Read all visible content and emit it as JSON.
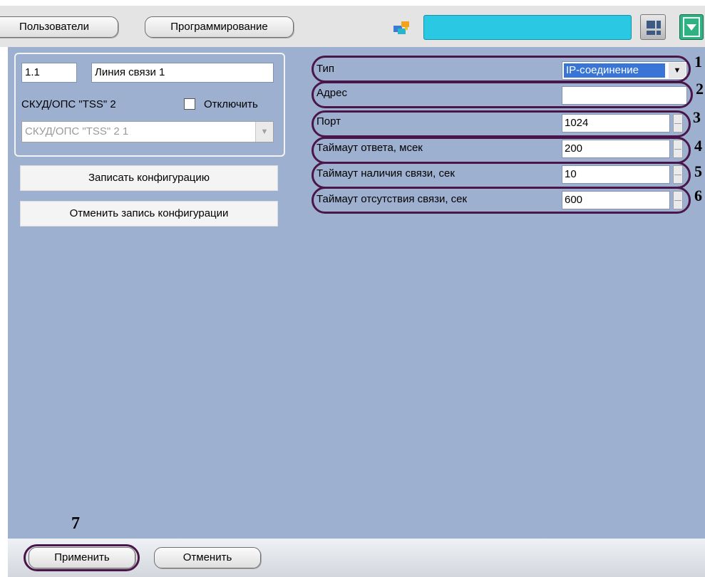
{
  "top_bar": {
    "users_label": "Пользователи",
    "programming_label": "Программирование"
  },
  "object": {
    "id": "1.1",
    "name": "Линия связи 1",
    "parent": "СКУД/ОПС \"TSS\" 2",
    "disable_label": "Отключить",
    "parent_combo": "СКУД/ОПС \"TSS\" 2 1"
  },
  "buttons": {
    "write_config": "Записать конфигурацию",
    "cancel_write_config": "Отменить запись конфигурации",
    "apply": "Применить",
    "cancel": "Отменить"
  },
  "properties": {
    "type_label": "Тип",
    "type_value": "IP-соединение",
    "address_label": "Адрес",
    "address_value": "",
    "port_label": "Порт",
    "port_value": "1024",
    "response_timeout_label": "Таймаут ответа, мсек",
    "response_timeout_value": "200",
    "connection_timeout_label": "Таймаут наличия связи, сек",
    "connection_timeout_value": "10",
    "disconnection_timeout_label": "Таймаут отсутствия связи, сек",
    "disconnection_timeout_value": "600"
  },
  "callouts": [
    "1",
    "2",
    "3",
    "4",
    "5",
    "6",
    "7"
  ],
  "colors": {
    "panel": "#9db0d0",
    "highlight_oval": "#4a1548",
    "selection": "#3875d7",
    "cyan_field": "#2bc8e3",
    "green_button": "#2fb184"
  }
}
